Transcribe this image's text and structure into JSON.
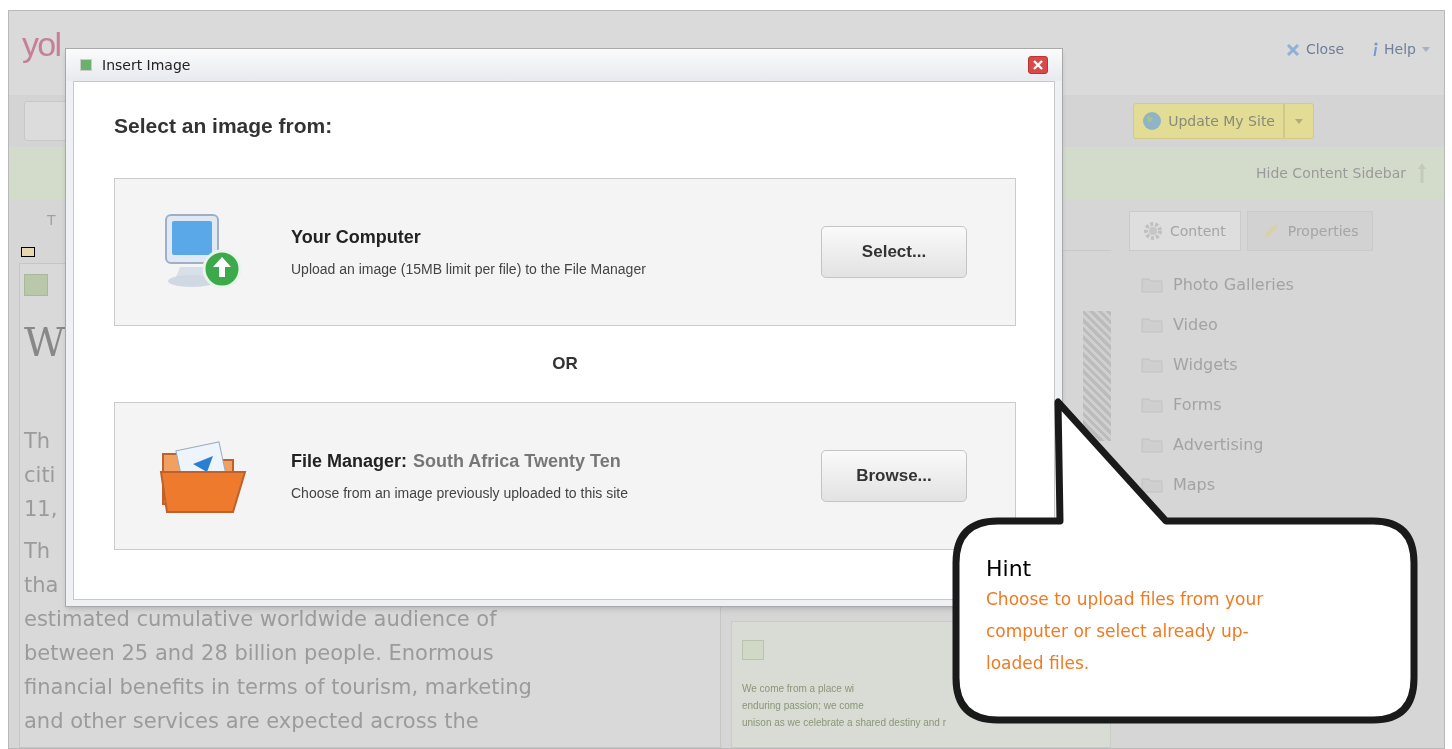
{
  "app": {
    "logo": "yol",
    "header_links": [
      {
        "kind": "close",
        "label": "Close"
      },
      {
        "kind": "help",
        "label": "Help"
      }
    ],
    "update_button": "Update My Site",
    "sidebar_toggle": "Hide Content Sidebar"
  },
  "sidebar": {
    "tabs": [
      {
        "label": "Content",
        "selected": true
      },
      {
        "label": "Properties",
        "selected": false
      }
    ],
    "items": [
      "Photo Galleries",
      "Video",
      "Widgets",
      "Forms",
      "Advertising",
      "Maps"
    ]
  },
  "page": {
    "tab_fragment": "T",
    "heading": "W",
    "lines": [
      "Th",
      "citi",
      "11,",
      "Th",
      "tha",
      "estimated cumulative worldwide audience of",
      "between 25 and 28 billion people. Enormous",
      "financial benefits in terms of tourism, marketing",
      "and other services are expected across the"
    ]
  },
  "content_block": {
    "lines": [
      "We come from a place wi",
      "enduring passion; we come",
      "unison as we celebrate a shared destiny and r"
    ]
  },
  "dialog": {
    "title": "Insert Image",
    "heading": "Select an image from:",
    "options": [
      {
        "kind": "computer",
        "title": "Your Computer",
        "description": "Upload an image (15MB limit per file) to the File Manager",
        "button": "Select..."
      },
      {
        "kind": "file_manager",
        "title": "File Manager:",
        "site": "South Africa Twenty Ten",
        "description": "Choose from an image previously uploaded to this site",
        "button": "Browse..."
      }
    ],
    "separator": "OR"
  },
  "hint": {
    "title": "Hint",
    "lines": [
      "Choose to upload files from your",
      "computer or select already up-",
      "loaded files."
    ]
  }
}
